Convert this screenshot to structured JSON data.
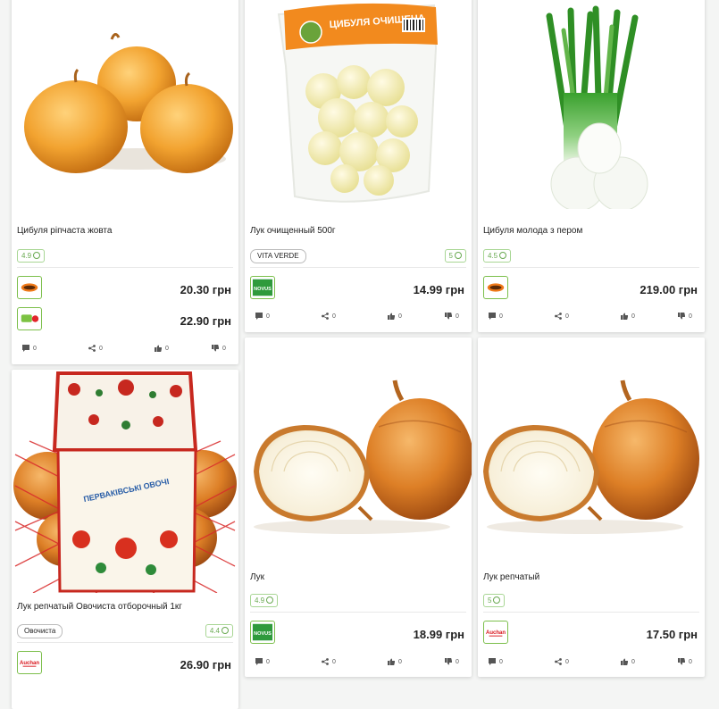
{
  "products": [
    {
      "title": "Цибуля ріпчаста жовта",
      "rating": "4.9",
      "brand": null,
      "offers": [
        {
          "store": "silpo",
          "store_label": "Сільпо",
          "price": "20.30 грн"
        },
        {
          "store": "dnipro-m",
          "store_label": "Дніпро-М",
          "price": "22.90 грн"
        }
      ],
      "actions": {
        "comments": "0",
        "shares": "0",
        "likes": "0",
        "dislikes": "0"
      }
    },
    {
      "title": "Лук очищенный 500г",
      "rating": "5",
      "brand": "VITA VERDE",
      "package_text": "ЦИБУЛЯ ОЧИЩЕНА",
      "offers": [
        {
          "store": "novus",
          "store_label": "NOVUS",
          "price": "14.99 грн"
        }
      ],
      "actions": {
        "comments": "0",
        "shares": "0",
        "likes": "0",
        "dislikes": "0"
      }
    },
    {
      "title": "Цибуля молода з пером",
      "rating": "4.5",
      "brand": null,
      "offers": [
        {
          "store": "silpo",
          "store_label": "Сільпо",
          "price": "219.00 грн"
        }
      ],
      "actions": {
        "comments": "0",
        "shares": "0",
        "likes": "0",
        "dislikes": "0"
      }
    },
    {
      "title": "Лук репчатый Овочиста отборочный 1кг",
      "rating": "4.4",
      "brand": "Овочиста",
      "package_text": "ПЕРВАКІВСЬКІ ОВОЧІ",
      "offers": [
        {
          "store": "auchan",
          "store_label": "Auchan",
          "price": "26.90 грн"
        }
      ],
      "actions": {
        "comments": "0",
        "shares": "0",
        "likes": "0",
        "dislikes": "0"
      }
    },
    {
      "title": "Лук",
      "rating": "4.9",
      "brand": null,
      "offers": [
        {
          "store": "novus",
          "store_label": "NOVUS",
          "price": "18.99 грн"
        }
      ],
      "actions": {
        "comments": "0",
        "shares": "0",
        "likes": "0",
        "dislikes": "0"
      }
    },
    {
      "title": "Лук репчатый",
      "rating": "5",
      "brand": null,
      "offers": [
        {
          "store": "auchan",
          "store_label": "Auchan",
          "price": "17.50 грн"
        }
      ],
      "actions": {
        "comments": "0",
        "shares": "0",
        "likes": "0",
        "dislikes": "0"
      }
    }
  ],
  "icons": {
    "rating": "smiley-icon",
    "comments": "comment-icon",
    "shares": "share-icon",
    "likes": "thumbs-up-icon",
    "dislikes": "thumbs-down-icon"
  },
  "colors": {
    "accent_green": "#6aaa52",
    "price_text": "#222222",
    "novus_green": "#2f9a3c",
    "auchan_red": "#d8141b",
    "silpo_orange": "#f07a1a"
  }
}
